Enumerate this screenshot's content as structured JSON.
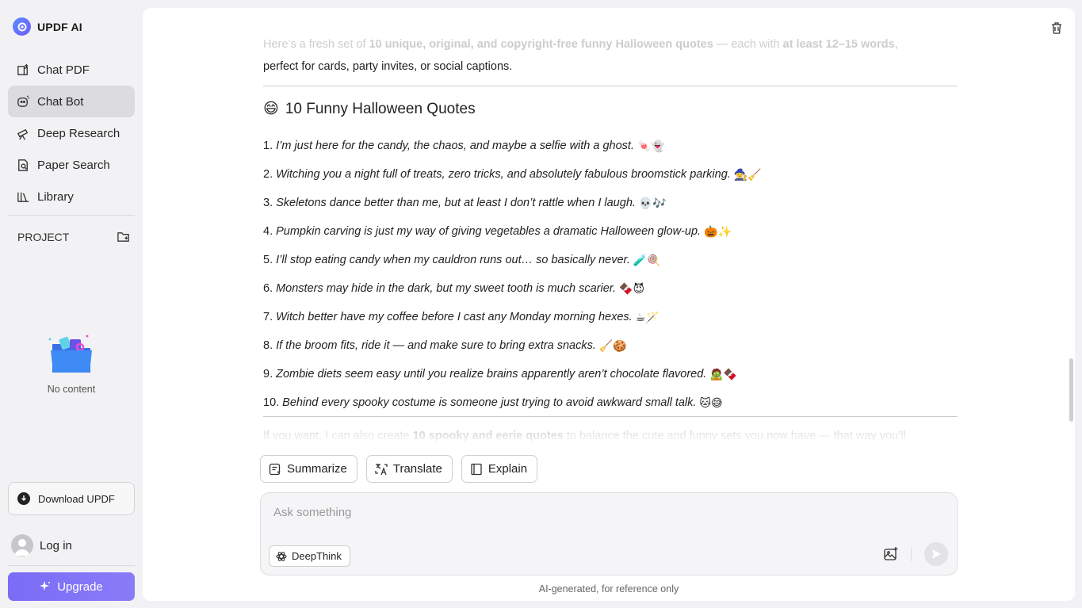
{
  "brand": {
    "name": "UPDF AI"
  },
  "nav": [
    {
      "label": "Chat PDF",
      "icon": "chat-pdf-icon"
    },
    {
      "label": "Chat Bot",
      "icon": "chat-bot-icon",
      "active": true
    },
    {
      "label": "Deep Research",
      "icon": "telescope-icon"
    },
    {
      "label": "Paper Search",
      "icon": "paper-search-icon"
    },
    {
      "label": "Library",
      "icon": "library-icon"
    }
  ],
  "project": {
    "label": "PROJECT",
    "empty_label": "No content"
  },
  "download": {
    "label": "Download UPDF"
  },
  "login": {
    "label": "Log in"
  },
  "upgrade": {
    "label": "Upgrade"
  },
  "chat": {
    "faded_intro_start": "Here’s a fresh set of ",
    "faded_intro_bold1": "10 unique, original, and copyright-free funny Halloween quotes",
    "faded_intro_mid": " — each with ",
    "faded_intro_bold2": "at least 12–15 words",
    "faded_intro_end": ",",
    "intro": "perfect for cards, party invites, or social captions.",
    "heading_emoji": "😄",
    "heading": "10 Funny Halloween Quotes",
    "quotes": [
      {
        "num": "1.",
        "text": "I’m just here for the candy, the chaos, and maybe a selfie with a ghost.",
        "emoji": "🍬👻"
      },
      {
        "num": "2.",
        "text": "Witching you a night full of treats, zero tricks, and absolutely fabulous broomstick parking.",
        "emoji": "🧙‍♀️🧹"
      },
      {
        "num": "3.",
        "text": "Skeletons dance better than me, but at least I don’t rattle when I laugh.",
        "emoji": "💀🎶"
      },
      {
        "num": "4.",
        "text": "Pumpkin carving is just my way of giving vegetables a dramatic Halloween glow-up.",
        "emoji": "🎃✨"
      },
      {
        "num": "5.",
        "text": "I’ll stop eating candy when my cauldron runs out… so basically never.",
        "emoji": "🧪🍭"
      },
      {
        "num": "6.",
        "text": "Monsters may hide in the dark, but my sweet tooth is much scarier.",
        "emoji": "🍫😈"
      },
      {
        "num": "7.",
        "text": "Witch better have my coffee before I cast any Monday morning hexes.",
        "emoji": "☕🪄"
      },
      {
        "num": "8.",
        "text": "If the broom fits, ride it — and make sure to bring extra snacks.",
        "emoji": "🧹🍪"
      },
      {
        "num": "9.",
        "text": "Zombie diets seem easy until you realize brains apparently aren’t chocolate flavored.",
        "emoji": "🧟🍫"
      },
      {
        "num": "10.",
        "text": "Behind every spooky costume is someone just trying to avoid awkward small talk.",
        "emoji": "🐱😅"
      }
    ],
    "outro_start": "If you want, I can also create ",
    "outro_bold": "10 spooky and eerie quotes",
    "outro_end": " to balance the cute and funny sets you now have — that way you’ll"
  },
  "actions": {
    "summarize": "Summarize",
    "translate": "Translate",
    "explain": "Explain"
  },
  "composer": {
    "placeholder": "Ask something",
    "deepthink": "DeepThink"
  },
  "footnote": "AI-generated, for reference only",
  "colors": {
    "accent": "#7a6cf6",
    "active_nav": "#dcdcdf"
  }
}
